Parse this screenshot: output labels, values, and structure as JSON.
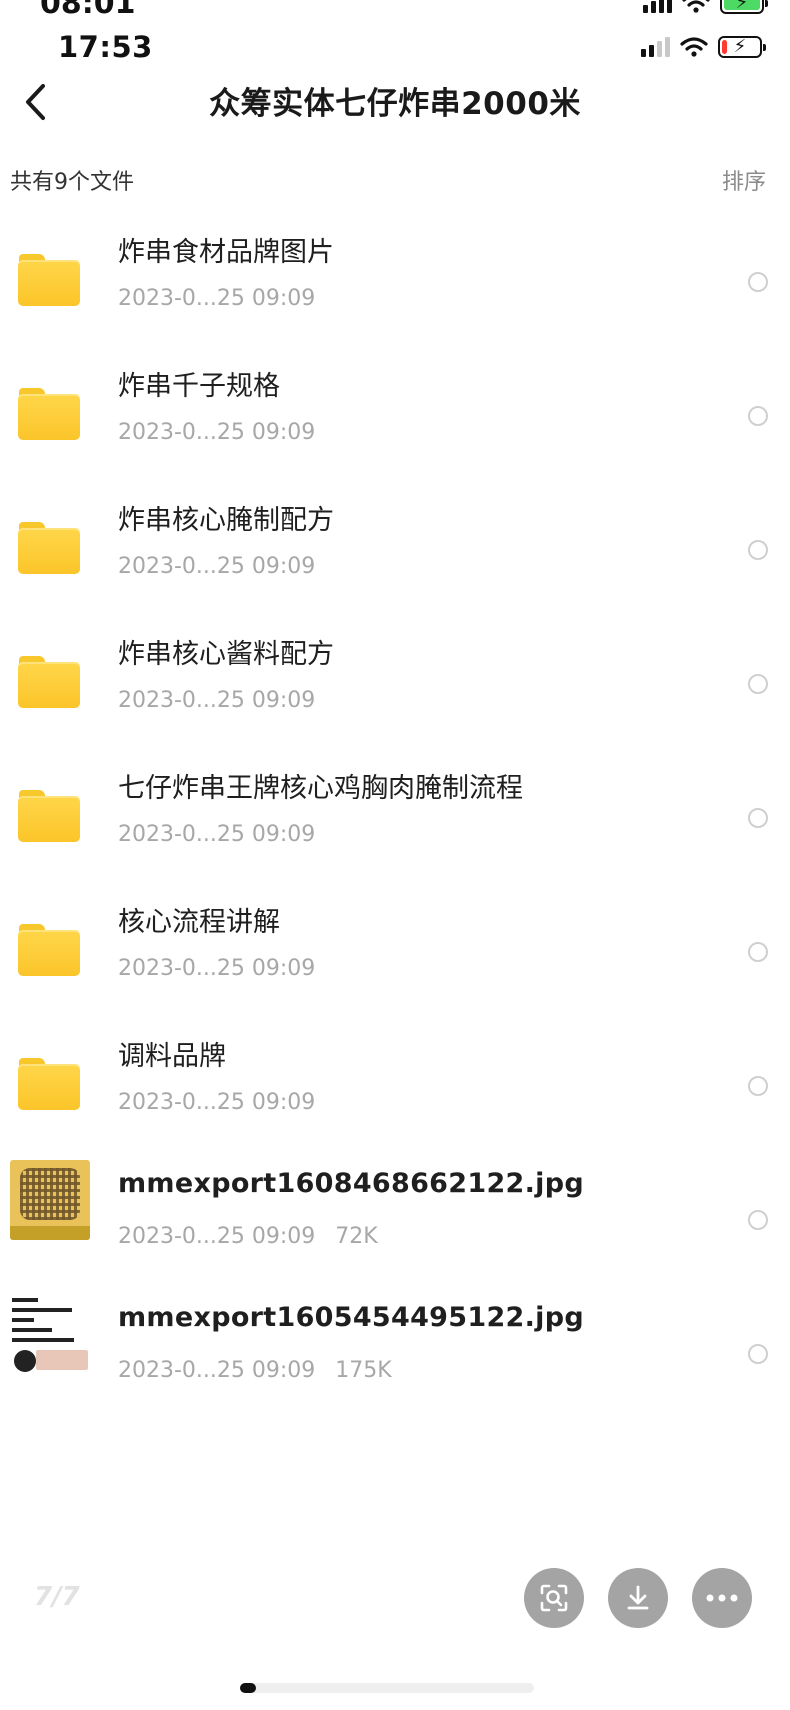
{
  "status_top": {
    "time": "08:01"
  },
  "status_bar": {
    "time": "17:53"
  },
  "nav": {
    "title": "众筹实体七仔炸串2000米"
  },
  "subheader": {
    "file_count": "共有9个文件",
    "sort_label": "排序"
  },
  "items": [
    {
      "name": "炸串食材品牌图片",
      "date": "2023-0...25 09:09",
      "size": "",
      "type": "folder"
    },
    {
      "name": "炸串千子规格",
      "date": "2023-0...25 09:09",
      "size": "",
      "type": "folder"
    },
    {
      "name": "炸串核心腌制配方",
      "date": "2023-0...25 09:09",
      "size": "",
      "type": "folder"
    },
    {
      "name": "炸串核心酱料配方",
      "date": "2023-0...25 09:09",
      "size": "",
      "type": "folder"
    },
    {
      "name": "七仔炸串王牌核心鸡胸肉腌制流程",
      "date": "2023-0...25 09:09",
      "size": "",
      "type": "folder"
    },
    {
      "name": "核心流程讲解",
      "date": "2023-0...25 09:09",
      "size": "",
      "type": "folder"
    },
    {
      "name": "调料品牌",
      "date": "2023-0...25 09:09",
      "size": "",
      "type": "folder"
    },
    {
      "name": "mmexport1608468662122.jpg",
      "date": "2023-0...25 09:09",
      "size": "72K",
      "type": "image"
    },
    {
      "name": "mmexport1605454495122.jpg",
      "date": "2023-0...25 09:09",
      "size": "175K",
      "type": "image"
    }
  ],
  "footer": {
    "page_indicator": "7/7"
  },
  "icons": {
    "back": "chevron-left-icon",
    "scan": "scan-search-icon",
    "download": "download-icon",
    "more": "more-horizontal-icon"
  },
  "colors": {
    "folder": "#fbc52a",
    "fab": "#a4a4a4",
    "meta_text": "#a7a7a7",
    "battery_charging": "#4cd964",
    "battery_low": "#ff3b30"
  }
}
